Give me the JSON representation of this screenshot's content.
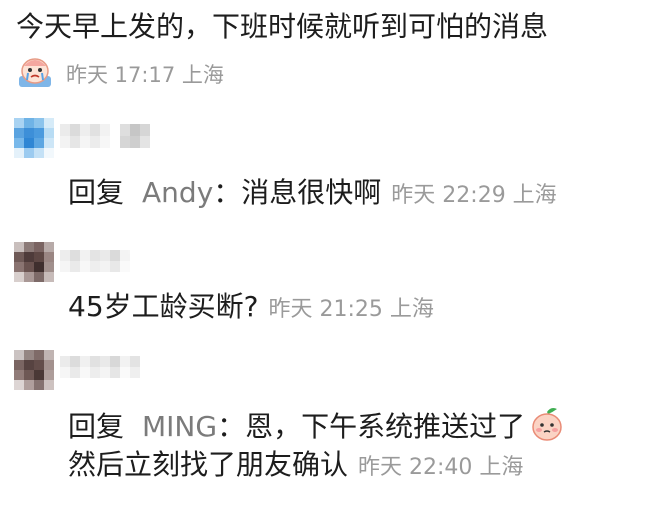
{
  "post": {
    "text": "今天早上发的，下班时候就听到可怕的消息",
    "time": "昨天 17:17 上海",
    "avatar_icon": "crying-sticker-icon"
  },
  "comments": [
    {
      "prefix": "回复",
      "reply_to": "Andy",
      "colon": "：",
      "text": "消息很快啊",
      "time": "昨天 22:29 上海"
    },
    {
      "text": "45岁工龄买断?",
      "time": "昨天 21:25 上海"
    },
    {
      "prefix": "回复",
      "reply_to": "MING",
      "colon": "：",
      "text": "恩，下午系统推送过了",
      "emoji_icon": "peach-sticker-icon",
      "text2": "然后立刻找了朋友确认",
      "time": "昨天 22:40 上海"
    }
  ],
  "colors": {
    "meta": "#9a9a9a",
    "reply_user": "#7b7b7b",
    "text": "#1d1d1d"
  }
}
